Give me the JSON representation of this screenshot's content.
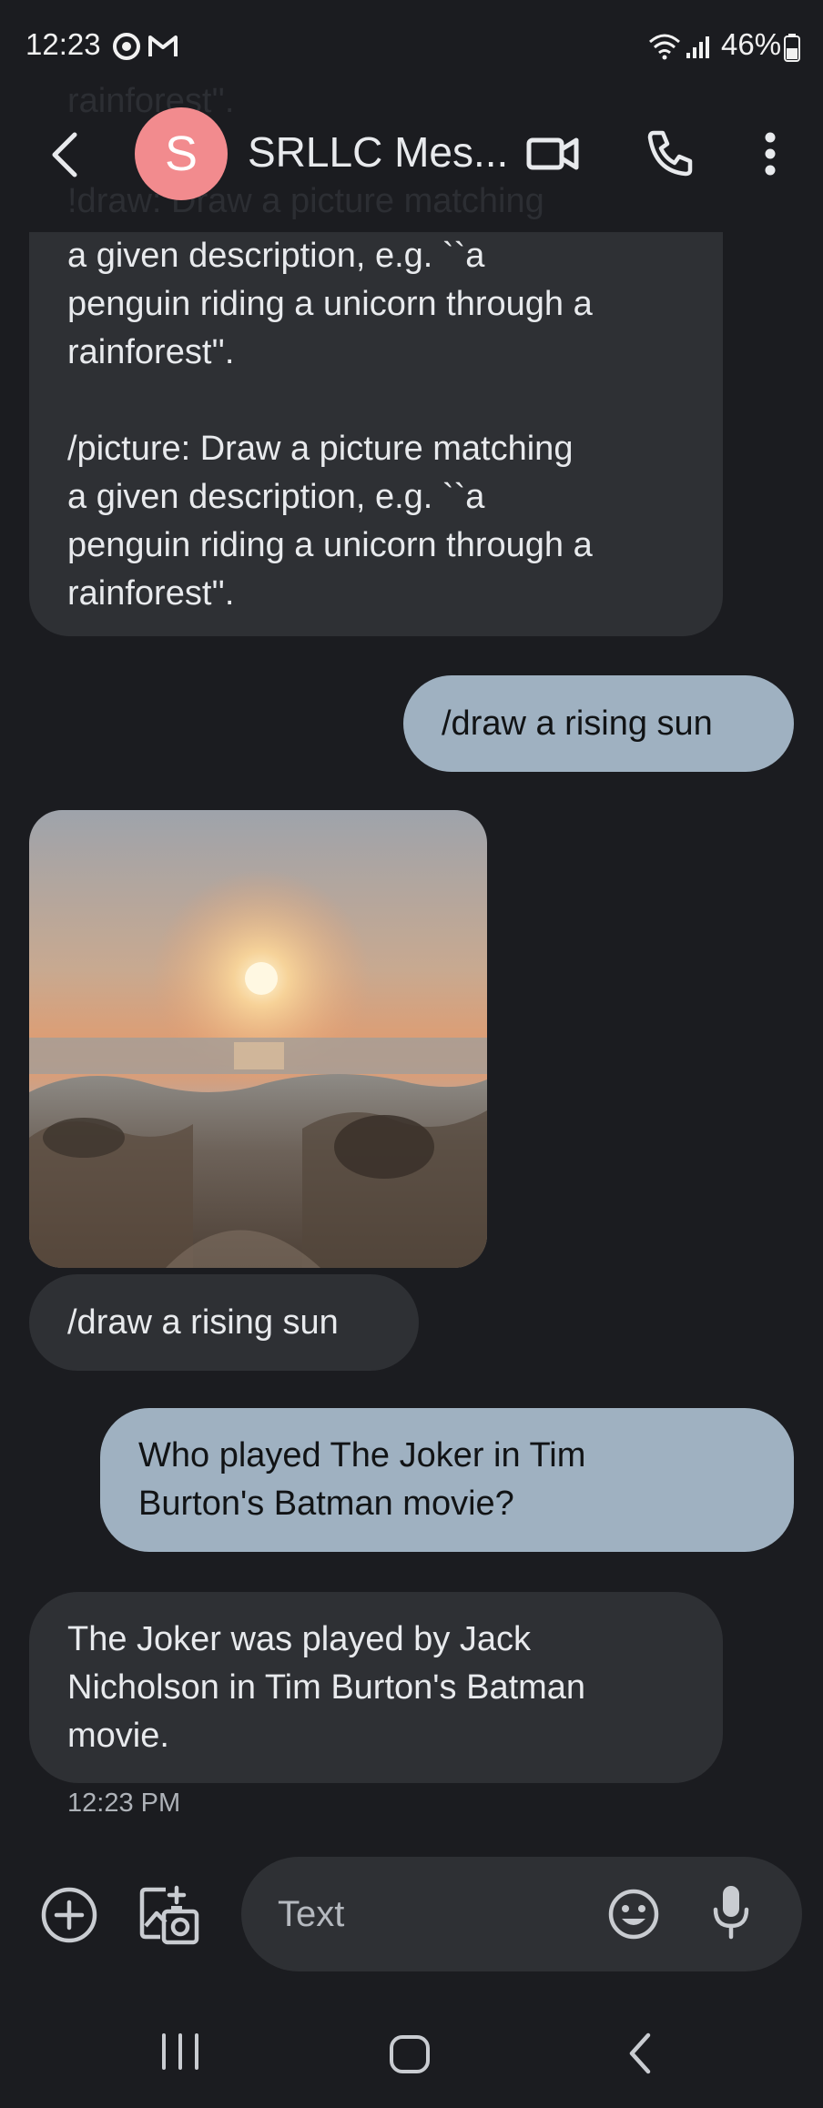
{
  "status_bar": {
    "time": "12:23",
    "battery": "46%"
  },
  "background_text": {
    "line1": "rainforest''.",
    "line2": "!draw: Draw a picture matching"
  },
  "header": {
    "avatar_letter": "S",
    "title": "SRLLC Mes..."
  },
  "messages": {
    "help_bubble": {
      "lines_a": [
        "a given description, e.g. ``a",
        "penguin riding a unicorn through a",
        "rainforest''."
      ],
      "lines_b": [
        "/picture: Draw a picture matching",
        "a given description, e.g. ``a",
        "penguin riding a unicorn through a",
        "rainforest''."
      ]
    },
    "sent_draw": "/draw a rising sun",
    "image_caption": "/draw a rising sun",
    "sent_question": {
      "lines": [
        "Who played The Joker in Tim",
        "Burton's Batman movie?"
      ]
    },
    "reply_answer": {
      "lines": [
        "The Joker was played by Jack",
        "Nicholson in Tim Burton's Batman",
        "movie."
      ]
    },
    "timestamp": "12:23 PM"
  },
  "compose": {
    "placeholder": "Text"
  },
  "colors": {
    "background": "#1b1c20",
    "incoming_bubble": "#2e3034",
    "outgoing_bubble": "#9fb1c1",
    "avatar": "#f28b8e"
  },
  "icons": {
    "status": [
      "alarm-icon",
      "gmail-icon",
      "wifi-icon",
      "signal-icon",
      "battery-icon"
    ],
    "header": [
      "back-arrow-icon",
      "video-call-icon",
      "phone-icon",
      "more-vert-icon"
    ],
    "compose": [
      "add-circle-icon",
      "gallery-icon",
      "emoji-icon",
      "mic-icon"
    ],
    "nav": [
      "recents-icon",
      "home-icon",
      "back-icon"
    ]
  }
}
